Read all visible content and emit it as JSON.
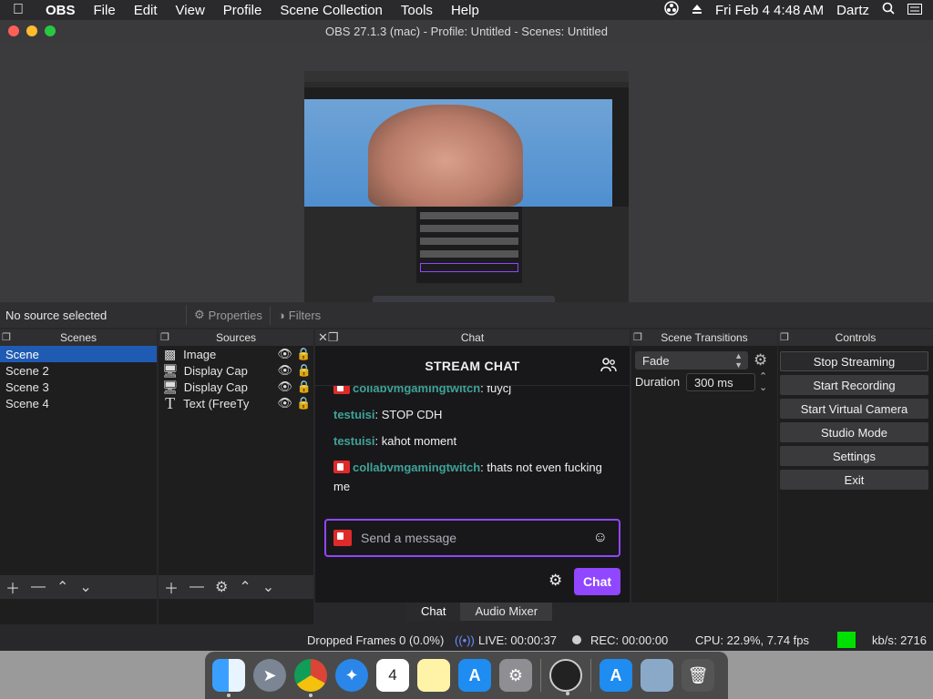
{
  "menubar": {
    "apple": "",
    "app": "OBS",
    "items": [
      "File",
      "Edit",
      "View",
      "Profile",
      "Scene Collection",
      "Tools",
      "Help"
    ],
    "datetime": "Fri Feb 4  4:48 AM",
    "user": "Dartz"
  },
  "window": {
    "title": "OBS 27.1.3 (mac) - Profile: Untitled - Scenes: Untitled"
  },
  "sourcebar": {
    "status": "No source selected",
    "properties": "Properties",
    "filters": "Filters"
  },
  "scenes": {
    "header": "Scenes",
    "items": [
      "Scene",
      "Scene 2",
      "Scene 3",
      "Scene 4"
    ]
  },
  "sources": {
    "header": "Sources",
    "items": [
      {
        "name": "Image",
        "icon": "image-icon"
      },
      {
        "name": "Display Cap",
        "icon": "monitor-icon"
      },
      {
        "name": "Display Cap",
        "icon": "monitor-icon"
      },
      {
        "name": "Text (FreeTy",
        "icon": "text-icon"
      }
    ]
  },
  "chat": {
    "header": "Chat",
    "title": "STREAM CHAT",
    "messages": [
      {
        "user": "collabvmgamingtwitch",
        "text": ": fuycj",
        "badge": true
      },
      {
        "user": "testuisi",
        "text": ": STOP CDH",
        "badge": false
      },
      {
        "user": "testuisi",
        "text": ": kahot moment",
        "badge": false
      },
      {
        "user": "collabvmgamingtwitch",
        "text": ": thats not even fucking me",
        "badge": true
      }
    ],
    "placeholder": "Send a message",
    "send_label": "Chat"
  },
  "tabs": [
    "Chat",
    "Audio Mixer"
  ],
  "transitions": {
    "header": "Scene Transitions",
    "selected": "Fade",
    "duration_label": "Duration",
    "duration_value": "300 ms"
  },
  "controls": {
    "header": "Controls",
    "buttons": [
      "Stop Streaming",
      "Start Recording",
      "Start Virtual Camera",
      "Studio Mode",
      "Settings",
      "Exit"
    ]
  },
  "status": {
    "dropped": "Dropped Frames 0 (0.0%)",
    "live": "LIVE: 00:00:37",
    "rec": "REC: 00:00:00",
    "cpu": "CPU: 22.9%, 7.74 fps",
    "kbs": "kb/s: 2716",
    "indicator_color": "#00e000"
  },
  "colors": {
    "accent": "#9146ff",
    "selection": "#1f5bb3",
    "username": "#3fa397"
  }
}
